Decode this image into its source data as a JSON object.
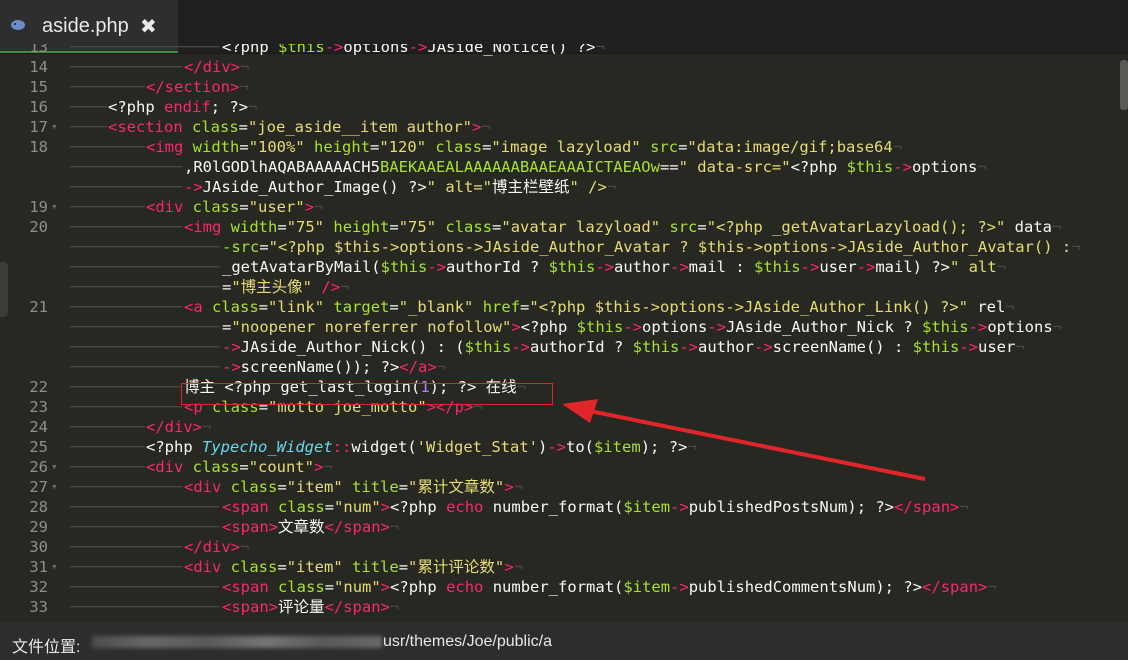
{
  "tab": {
    "title": "aside.php",
    "close_icon": "close-icon",
    "file_icon": "php-elephant-icon"
  },
  "status": {
    "label": "文件位置:",
    "path": "usr/themes/Joe/public/a"
  },
  "colors": {
    "background": "#272822",
    "tag": "#f92672",
    "attr": "#a6e22e",
    "string": "#e6db74",
    "var": "#a6e22e",
    "keyword": "#66d9ef",
    "annotation": "#e0262b"
  },
  "line_numbers": [
    "13",
    "14",
    "15",
    "16",
    "17",
    "18",
    "",
    "",
    "19",
    "20",
    "",
    "",
    "",
    "21",
    "",
    "",
    "",
    "22",
    "23",
    "24",
    "25",
    "26",
    "27",
    "28",
    "29",
    "30",
    "31",
    "32",
    "33"
  ],
  "lines": [
    "<?php $this->options->JAside_Notice() ?>",
    "</div>",
    "</section>",
    "<?php endif; ?>",
    "<section class=\"joe_aside__item author\">",
    "<img width=\"100%\" height=\"120\" class=\"image lazyload\" src=\"data:image/gif;base64",
    ",R0lGODlhAQABAAAAACH5BAEKAAEALAAAAAABAAEAAAICTAEAOw==\" data-src=\"<?php $this->options",
    "->JAside_Author_Image() ?>\" alt=\"博主栏壁纸\" />",
    "<div class=\"user\">",
    "<img width=\"75\" height=\"75\" class=\"avatar lazyload\" src=\"<?php _getAvatarLazyload(); ?>\" data",
    "-src=\"<?php $this->options->JAside_Author_Avatar ? $this->options->JAside_Author_Avatar() :",
    "_getAvatarByMail($this->authorId ? $this->author->mail : $this->user->mail) ?>\" alt",
    "=\"博主头像\" />",
    "<a class=\"link\" target=\"_blank\" href=\"<?php $this->options->JAside_Author_Link() ?>\" rel",
    "=\"noopener noreferrer nofollow\"><?php $this->options->JAside_Author_Nick ? $this->options",
    "->JAside_Author_Nick() : ($this->authorId ? $this->author->screenName() : $this->user",
    "->screenName()); ?></a>",
    "博主 <?php get_last_login(1); ?> 在线",
    "<p class=\"motto joe_motto\"></p>",
    "</div>",
    "<?php Typecho_Widget::widget('Widget_Stat')->to($item); ?>",
    "<div class=\"count\">",
    "<div class=\"item\" title=\"累计文章数\">",
    "<span class=\"num\"><?php echo number_format($item->publishedPostsNum); ?></span>",
    "<span>文章数</span>",
    "</div>",
    "<div class=\"item\" title=\"累计评论数\">",
    "<span class=\"num\"><?php echo number_format($item->publishedCommentsNum); ?></span>",
    "<span>评论量</span>"
  ]
}
